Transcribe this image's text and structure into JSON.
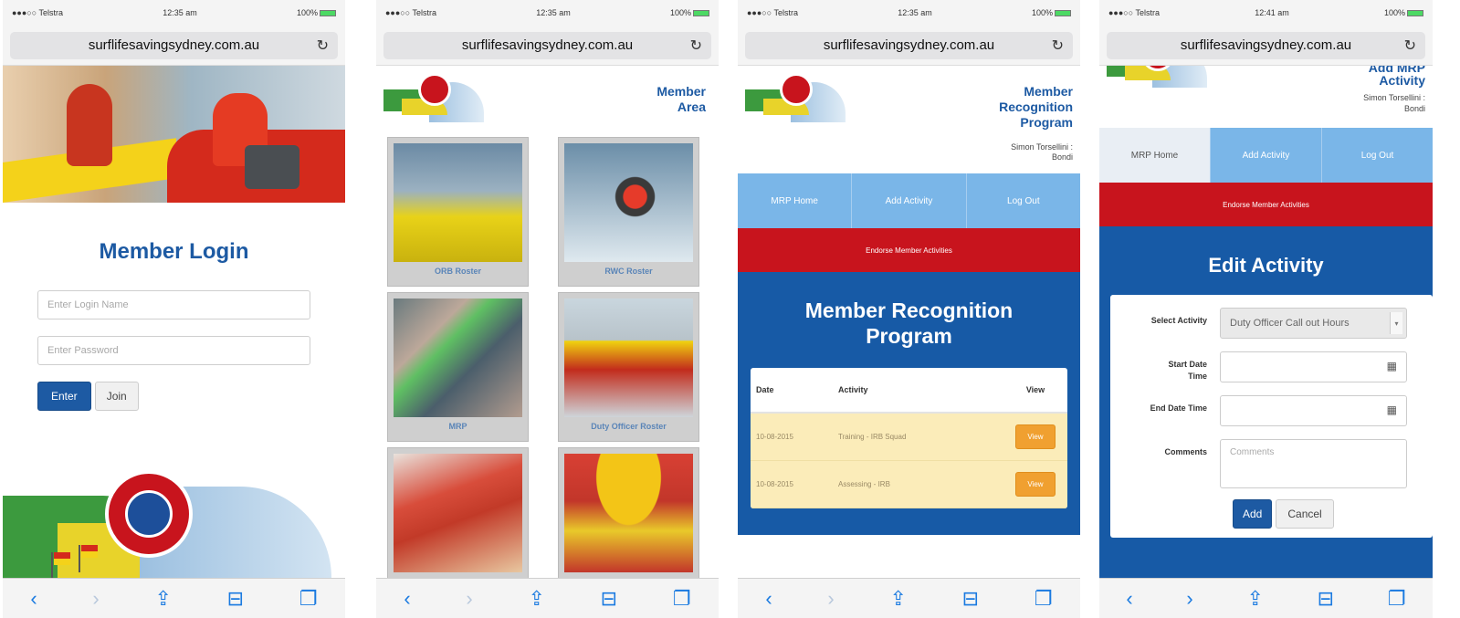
{
  "status": {
    "carrier_1": "●●●○○ Telstra",
    "time_1": "12:35 am",
    "time_2": "12:35 am",
    "time_3": "12:35 am",
    "time_4": "12:41 am",
    "battery": "100%"
  },
  "browser": {
    "url": "surflifesavingsydney.com.au"
  },
  "login": {
    "title": "Member Login",
    "login_placeholder": "Enter Login Name",
    "password_placeholder": "Enter Password",
    "enter_label": "Enter",
    "join_label": "Join"
  },
  "member_area": {
    "title": "Member Area",
    "tiles": [
      {
        "label": "ORB Roster"
      },
      {
        "label": "RWC Roster"
      },
      {
        "label": "MRP"
      },
      {
        "label": "Duty Officer Roster"
      },
      {
        "label": ""
      },
      {
        "label": ""
      }
    ]
  },
  "mrp": {
    "header_title": "Member Recognition Program",
    "user": "Simon Torsellini : Bondi",
    "nav": [
      "MRP Home",
      "Add Activity",
      "Log Out"
    ],
    "endorse": "Endorse Member Activities",
    "panel_title": "Member Recognition Program",
    "table": {
      "columns": [
        "Date",
        "Activity",
        "View"
      ],
      "rows": [
        {
          "date": "10-08-2015",
          "activity": "Training - IRB Squad",
          "view": "View"
        },
        {
          "date": "10-08-2015",
          "activity": "Assessing - IRB",
          "view": "View"
        }
      ]
    }
  },
  "edit": {
    "header_title_partial": "Add MRP",
    "header_title": "Activity",
    "user_name": "Simon Torsellini :",
    "user_club": "Bondi",
    "panel_title": "Edit Activity",
    "select_label": "Select Activity",
    "select_value": "Duty Officer Call out Hours",
    "start_label": "Start Date Time",
    "end_label": "End Date Time",
    "comments_label": "Comments",
    "comments_placeholder": "Comments",
    "add_label": "Add",
    "cancel_label": "Cancel"
  },
  "colors": {
    "brand_blue": "#1d5aa3",
    "nav_blue": "#7ab6e8",
    "endorse_red": "#c8141d",
    "view_orange": "#f0a030"
  }
}
